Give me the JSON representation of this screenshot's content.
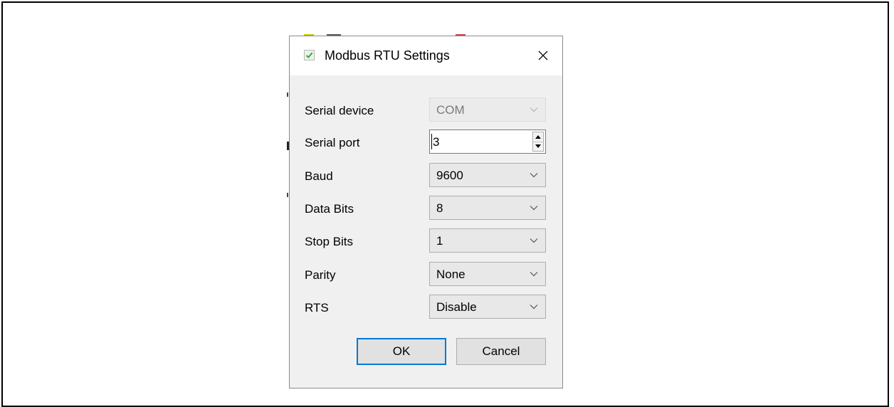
{
  "dialog": {
    "title": "Modbus RTU Settings",
    "close_glyph": "✕",
    "fields": {
      "serial_device": {
        "label": "Serial device",
        "value": "COM",
        "disabled": true
      },
      "serial_port": {
        "label": "Serial port",
        "value": "3"
      },
      "baud": {
        "label": "Baud",
        "value": "9600"
      },
      "data_bits": {
        "label": "Data Bits",
        "value": "8"
      },
      "stop_bits": {
        "label": "Stop Bits",
        "value": "1"
      },
      "parity": {
        "label": "Parity",
        "value": "None"
      },
      "rts": {
        "label": "RTS",
        "value": "Disable"
      }
    },
    "buttons": {
      "ok": "OK",
      "cancel": "Cancel"
    }
  },
  "colors": {
    "dialog_bg": "#f0f0f0",
    "titlebar_bg": "#ffffff",
    "default_button_border": "#0078d7",
    "app_icon_check": "#3aa64a"
  },
  "icons": {
    "app": "checkmark-icon",
    "close": "close-icon",
    "dropdown": "chevron-down-icon",
    "spin_up": "spin-up-icon",
    "spin_down": "spin-down-icon"
  }
}
